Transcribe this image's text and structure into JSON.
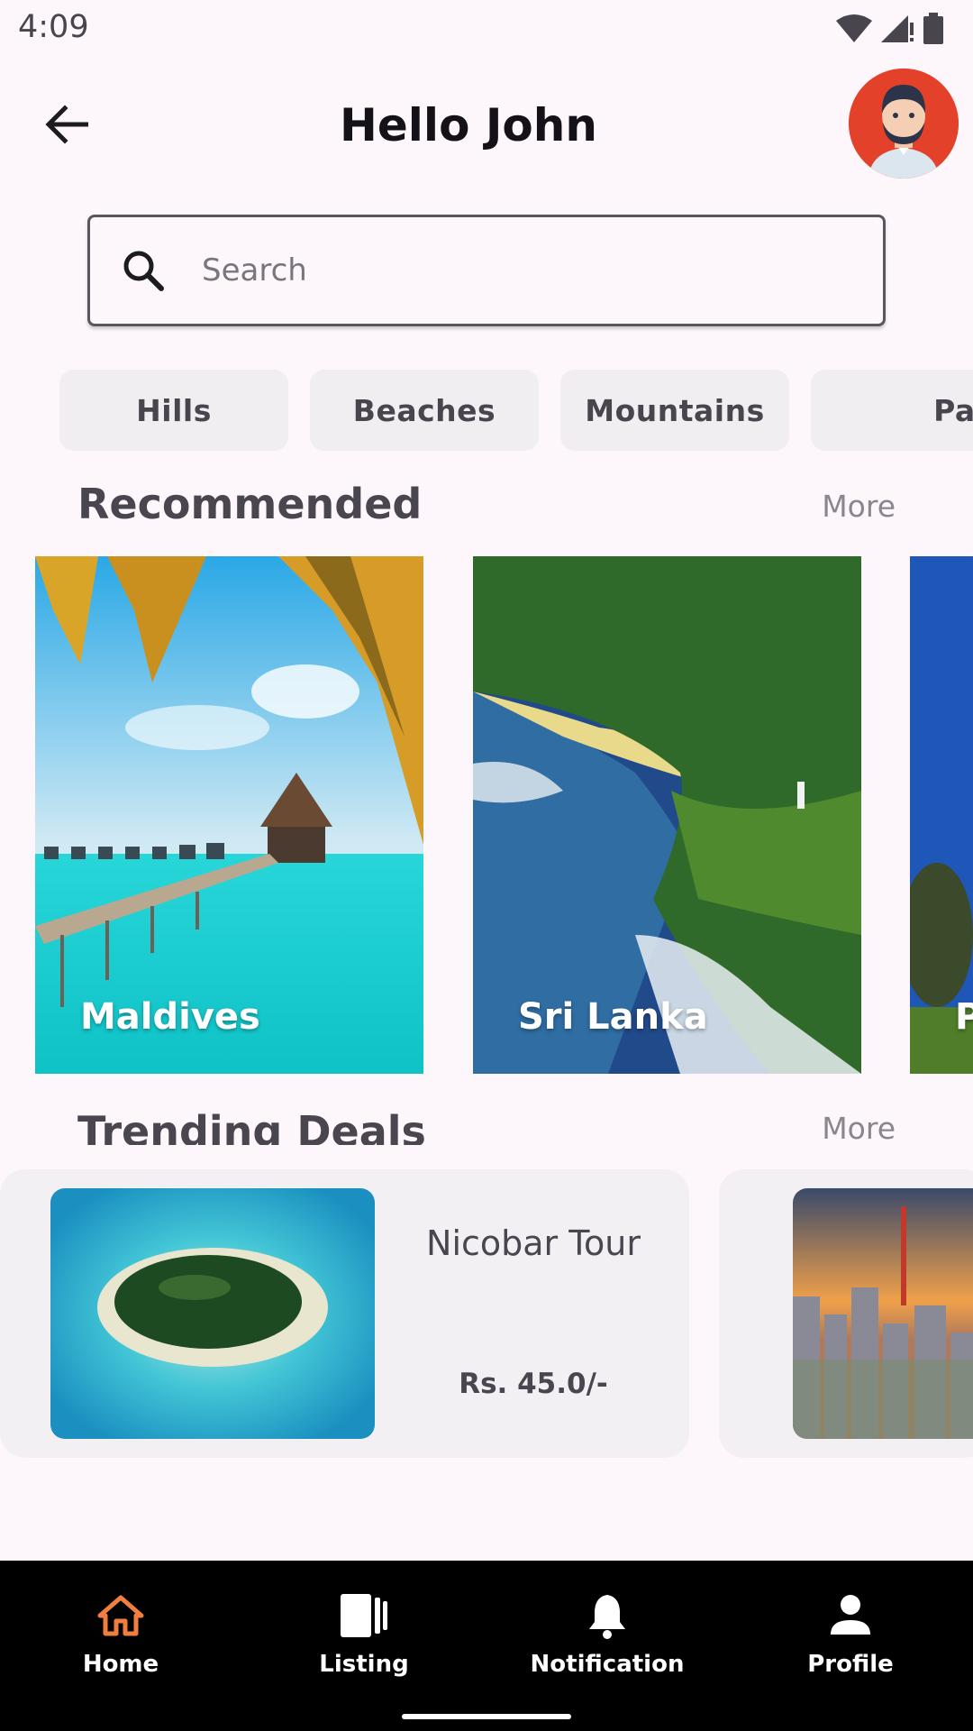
{
  "status_bar": {
    "time": "4:09"
  },
  "header": {
    "title": "Hello John"
  },
  "search": {
    "placeholder": "Search"
  },
  "categories": [
    "Hills",
    "Beaches",
    "Mountains",
    "Parks"
  ],
  "recommended": {
    "title": "Recommended",
    "more_label": "More",
    "items": [
      {
        "label": "Maldives"
      },
      {
        "label": "Sri Lanka"
      },
      {
        "label": "P"
      }
    ]
  },
  "trending": {
    "title": "Trending Deals",
    "more_label": "More",
    "items": [
      {
        "name": "Nicobar Tour",
        "price": "Rs. 45.0/-"
      }
    ]
  },
  "bottom_nav": {
    "items": [
      {
        "label": "Home",
        "icon": "home-icon"
      },
      {
        "label": "Listing",
        "icon": "listing-icon"
      },
      {
        "label": "Notification",
        "icon": "bell-icon"
      },
      {
        "label": "Profile",
        "icon": "person-icon"
      }
    ]
  },
  "colors": {
    "accent": "#f07e3f",
    "background": "#fdf7fb",
    "nav_background": "#000000",
    "avatar_bg": "#e4412a"
  }
}
